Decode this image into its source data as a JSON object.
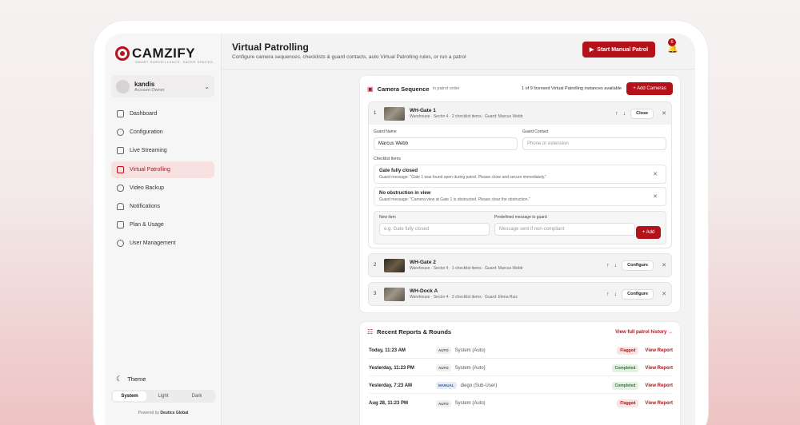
{
  "brand": {
    "name": "CAMZIFY",
    "tagline": "SMART SURVEILLANCE. SAFER SPACES."
  },
  "user": {
    "name": "kandis",
    "role": "Account Owner"
  },
  "nav": [
    {
      "label": "Dashboard",
      "icon": "grid-icon"
    },
    {
      "label": "Configuration",
      "icon": "gear-icon"
    },
    {
      "label": "Live Streaming",
      "icon": "camera-icon"
    },
    {
      "label": "Virtual Patrolling",
      "icon": "stack-icon",
      "active": true
    },
    {
      "label": "Video Backup",
      "icon": "cloud-icon"
    },
    {
      "label": "Notifications",
      "icon": "bell-icon"
    },
    {
      "label": "Plan & Usage",
      "icon": "document-icon"
    },
    {
      "label": "User Management",
      "icon": "users-icon"
    }
  ],
  "theme": {
    "label": "Theme",
    "options": [
      "System",
      "Light",
      "Dark"
    ],
    "selected": "System"
  },
  "powered": {
    "prefix": "Powered by",
    "company": "Deutics Global"
  },
  "header": {
    "title": "Virtual Patrolling",
    "subtitle": "Configure camera sequences, checklists & guard contacts, auto Virtual Patrolling rules, or run a patrol",
    "start_button": "Start Manual Patrol",
    "notification_count": "6"
  },
  "sequence": {
    "title": "Camera Sequence",
    "note": "in patrol order",
    "license_text": "1 of 9 licensed Virtual Patrolling instances available",
    "add_button": "+ Add Cameras",
    "cameras": [
      {
        "index": "1",
        "name": "WH-Gate 1",
        "meta": "Warehouse · Sector 4 · 2 checklist items · Guard: Marcus Webb",
        "action": "Close"
      },
      {
        "index": "2",
        "name": "WH-Gate 2",
        "meta": "Warehouse · Sector 4 · 1 checklist items · Guard: Marcus Webb",
        "action": "Configure"
      },
      {
        "index": "3",
        "name": "WH-Dock A",
        "meta": "Warehouse · Sector 4 · 2 checklist items · Guard: Elena Ruiz",
        "action": "Configure"
      }
    ],
    "editor": {
      "guard_name_label": "Guard Name",
      "guard_name_value": "Marcus Webb",
      "guard_contact_label": "Guard Contact",
      "guard_contact_placeholder": "Phone or extension",
      "checklist_label": "Checklist Items",
      "items": [
        {
          "title": "Gate fully closed",
          "message": "Guard message: \"Gate 1 was found open during patrol. Please close and secure immediately.\""
        },
        {
          "title": "No obstruction in view",
          "message": "Guard message: \"Camera view at Gate 1 is obstructed. Please clear the obstruction.\""
        }
      ],
      "new_item_label": "New item",
      "new_item_placeholder": "e.g. Gate fully closed",
      "predefined_label": "Predefined message to guard",
      "predefined_placeholder": "Message sent if non-compliant",
      "add_label": "+ Add"
    }
  },
  "reports": {
    "title": "Recent Reports & Rounds",
    "link": "View full patrol history →",
    "rows": [
      {
        "when": "Today, 11:23 AM",
        "tag": "AUTO",
        "source": "System (Auto)",
        "status": "Flagged",
        "action": "View Report"
      },
      {
        "when": "Yesterday, 11:23 PM",
        "tag": "AUTO",
        "source": "System (Auto)",
        "status": "Completed",
        "action": "View Report"
      },
      {
        "when": "Yesterday, 7:23 AM",
        "tag": "MANUAL",
        "source": "diego (Sub-User)",
        "status": "Completed",
        "action": "View Report"
      },
      {
        "when": "Aug 28, 11:23 PM",
        "tag": "AUTO",
        "source": "System (Auto)",
        "status": "Flagged",
        "action": "View Report"
      }
    ]
  },
  "colors": {
    "accent": "#b3121b",
    "flagged": "#b3121b",
    "completed": "#2e7d32"
  }
}
